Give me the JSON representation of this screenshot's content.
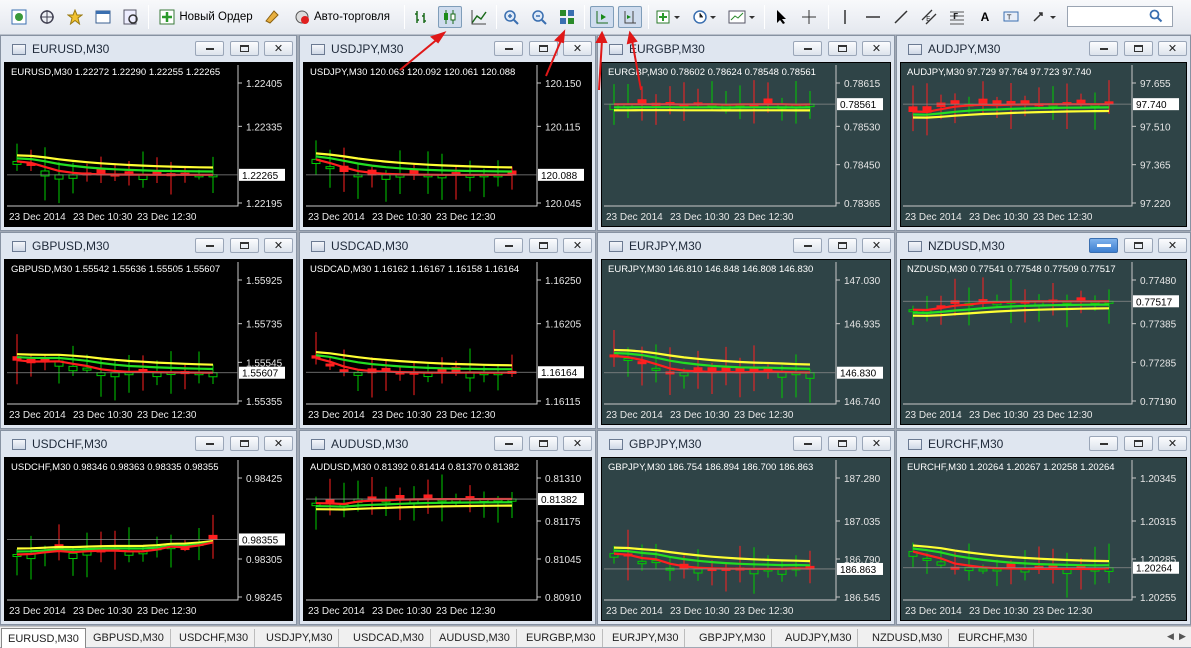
{
  "toolbar": {
    "new_order_label": "Новый Ордер",
    "autotrading_label": "Авто-торговля",
    "chart_label_a": "A",
    "search_placeholder": ""
  },
  "colors": {
    "buy_arrow": "#e01818",
    "bull": "#00cc00",
    "bear": "#ff2020",
    "ma_yellow": "#ffff33",
    "ma_green": "#22dd22",
    "ma_red": "#ff1f1f",
    "label_bg": "#ffffff"
  },
  "windows": [
    {
      "title": "EURUSD,M30",
      "bg": "#000000",
      "header": "EURUSD,M30  1.22272 1.22290 1.22255 1.22265",
      "ticks": [
        "1.22405",
        "1.22335",
        "",
        "1.22195"
      ],
      "price": "1.22265",
      "times": [
        "23 Dec 2014",
        "23 Dec 10:30",
        "23 Dec 12:30"
      ],
      "active": false
    },
    {
      "title": "USDJPY,M30",
      "bg": "#000000",
      "header": "USDJPY,M30  120.063 120.092 120.061 120.088",
      "ticks": [
        "120.150",
        "120.115",
        "",
        "120.045"
      ],
      "price": "120.088",
      "times": [
        "23 Dec 2014",
        "23 Dec 10:30",
        "23 Dec 12:30"
      ],
      "active": false
    },
    {
      "title": "EURGBP,M30",
      "bg": "#2f4447",
      "header": "EURGBP,M30  0.78602 0.78624 0.78548 0.78561",
      "ticks": [
        "0.78615",
        "0.78530",
        "0.78450",
        "0.78365"
      ],
      "price": "0.78561",
      "times": [
        "23 Dec 2014",
        "23 Dec 10:30",
        "23 Dec 12:30"
      ],
      "active": false
    },
    {
      "title": "AUDJPY,M30",
      "bg": "#2f4447",
      "header": "AUDJPY,M30  97.729 97.764 97.723 97.740",
      "ticks": [
        "97.655",
        "97.510",
        "97.365",
        "97.220"
      ],
      "price": "97.740",
      "times": [
        "23 Dec 2014",
        "23 Dec 10:30",
        "23 Dec 12:30"
      ],
      "active": false
    },
    {
      "title": "GBPUSD,M30",
      "bg": "#000000",
      "header": "GBPUSD,M30  1.55542 1.55636 1.55505 1.55607",
      "ticks": [
        "1.55925",
        "1.55735",
        "1.55545",
        "1.55355"
      ],
      "price": "1.55607",
      "times": [
        "23 Dec 2014",
        "23 Dec 10:30",
        "23 Dec 12:30"
      ],
      "active": false
    },
    {
      "title": "USDCAD,M30",
      "bg": "#000000",
      "header": "USDCAD,M30  1.16162 1.16167 1.16158 1.16164",
      "ticks": [
        "1.16250",
        "1.16205",
        "",
        "1.16115"
      ],
      "price": "1.16164",
      "times": [
        "23 Dec 2014",
        "23 Dec 10:30",
        "23 Dec 12:30"
      ],
      "active": false
    },
    {
      "title": "EURJPY,M30",
      "bg": "#2f4447",
      "header": "EURJPY,M30  146.810 146.848 146.808 146.830",
      "ticks": [
        "147.030",
        "146.935",
        "",
        "146.740"
      ],
      "price": "146.830",
      "times": [
        "23 Dec 2014",
        "23 Dec 10:30",
        "23 Dec 12:30"
      ],
      "active": false
    },
    {
      "title": "NZDUSD,M30",
      "bg": "#2f4447",
      "header": "NZDUSD,M30  0.77541 0.77548 0.77509 0.77517",
      "ticks": [
        "0.77480",
        "0.77385",
        "0.77285",
        "0.77190"
      ],
      "price": "0.77517",
      "times": [
        "23 Dec 2014",
        "23 Dec 10:30",
        "23 Dec 12:30"
      ],
      "active": true
    },
    {
      "title": "USDCHF,M30",
      "bg": "#000000",
      "header": "USDCHF,M30  0.98346 0.98363 0.98335 0.98355",
      "ticks": [
        "0.98425",
        "",
        "0.98305",
        "0.98245"
      ],
      "price": "0.98355",
      "times": [
        "23 Dec 2014",
        "23 Dec 10:30",
        "23 Dec 12:30"
      ],
      "active": false
    },
    {
      "title": "AUDUSD,M30",
      "bg": "#000000",
      "header": "AUDUSD,M30  0.81392 0.81414 0.81370 0.81382",
      "ticks": [
        "0.81310",
        "0.81175",
        "0.81045",
        "0.80910"
      ],
      "price": "0.81382",
      "times": [
        "23 Dec 2014",
        "23 Dec 10:30",
        "23 Dec 12:30"
      ],
      "active": false
    },
    {
      "title": "GBPJPY,M30",
      "bg": "#2f4447",
      "header": "GBPJPY,M30  186.754 186.894 186.700 186.863",
      "ticks": [
        "187.280",
        "187.035",
        "186.790",
        "186.545"
      ],
      "price": "186.863",
      "times": [
        "23 Dec 2014",
        "23 Dec 10:30",
        "23 Dec 12:30"
      ],
      "active": false
    },
    {
      "title": "EURCHF,M30",
      "bg": "#2f4447",
      "header": "EURCHF,M30  1.20264 1.20267 1.20258 1.20264",
      "ticks": [
        "1.20345",
        "1.20315",
        "1.20285",
        "1.20255"
      ],
      "price": "1.20264",
      "times": [
        "23 Dec 2014",
        "23 Dec 10:30",
        "23 Dec 12:30"
      ],
      "active": false
    }
  ],
  "tabs": [
    "EURUSD,M30",
    "GBPUSD,M30",
    "USDCHF,M30",
    "USDJPY,M30",
    "USDCAD,M30",
    "AUDUSD,M30",
    "EURGBP,M30",
    "EURJPY,M30",
    "GBPJPY,M30",
    "AUDJPY,M30",
    "NZDUSD,M30",
    "EURCHF,M30"
  ],
  "active_tab": 0
}
